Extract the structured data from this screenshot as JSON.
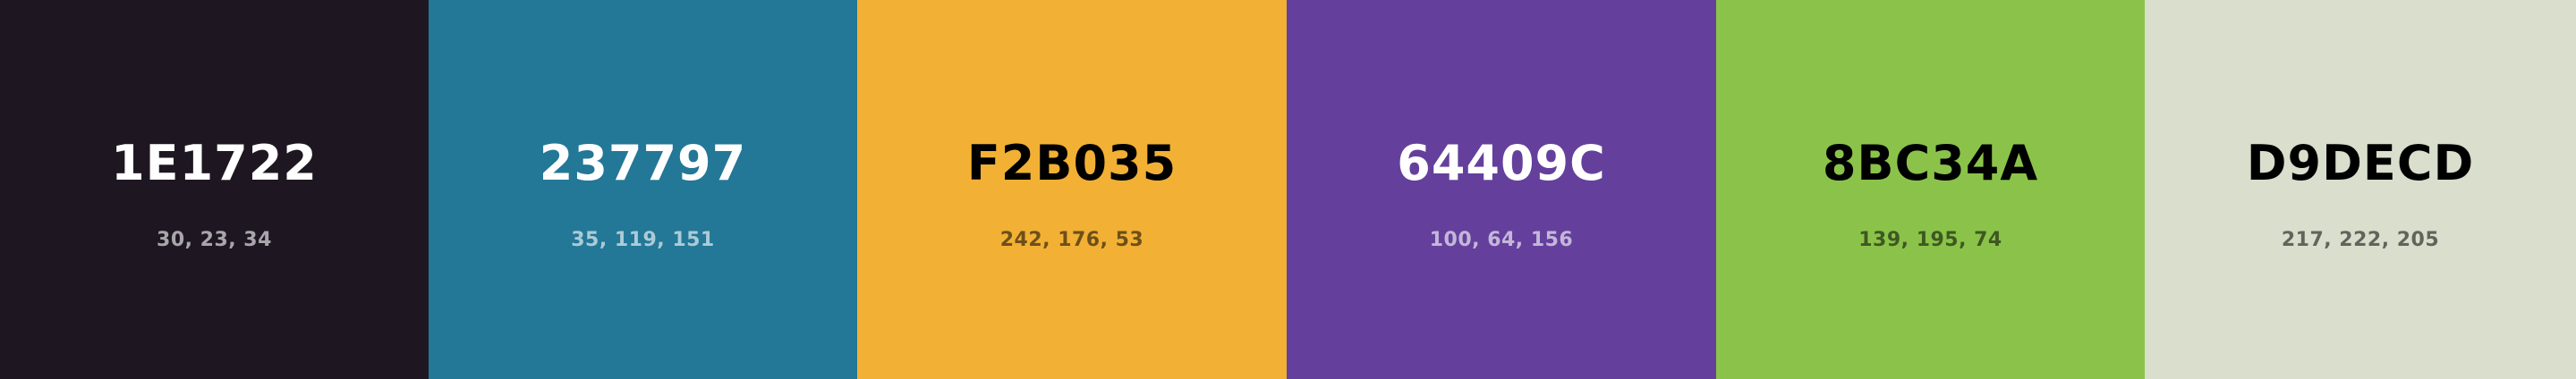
{
  "colors": [
    {
      "hex": "1E1722",
      "rgb": "30, 23, 34",
      "bg": "#1E1722"
    },
    {
      "hex": "237797",
      "rgb": "35, 119, 151",
      "bg": "#237797"
    },
    {
      "hex": "F2B035",
      "rgb": "242, 176, 53",
      "bg": "#F2B035"
    },
    {
      "hex": "64409C",
      "rgb": "100, 64, 156",
      "bg": "#64409C"
    },
    {
      "hex": "8BC34A",
      "rgb": "139, 195, 74",
      "bg": "#8BC34A"
    },
    {
      "hex": "D9DECD",
      "rgb": "217, 222, 205",
      "bg": "#D9DECD"
    }
  ]
}
